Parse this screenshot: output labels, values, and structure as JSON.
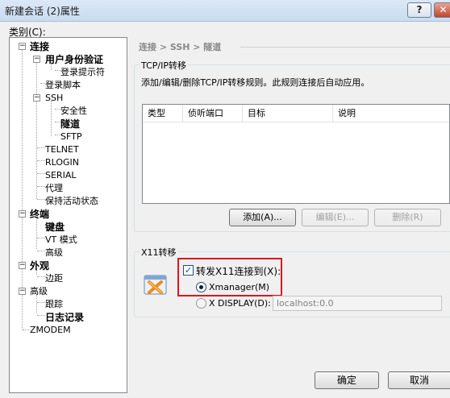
{
  "window": {
    "title": "新建会话 (2)属性",
    "help_label": "?",
    "close_label": "✕"
  },
  "category": {
    "label": "类别(C):",
    "tree": [
      {
        "label": "连接",
        "bold": true
      },
      {
        "label": "用户身份验证",
        "bold": true
      },
      {
        "label": "登录提示符",
        "bold": false
      },
      {
        "label": "登录脚本",
        "bold": false
      },
      {
        "label": "SSH",
        "bold": false
      },
      {
        "label": "安全性",
        "bold": false
      },
      {
        "label": "隧道",
        "bold": true
      },
      {
        "label": "SFTP",
        "bold": false
      },
      {
        "label": "TELNET",
        "bold": false
      },
      {
        "label": "RLOGIN",
        "bold": false
      },
      {
        "label": "SERIAL",
        "bold": false
      },
      {
        "label": "代理",
        "bold": false
      },
      {
        "label": "保持活动状态",
        "bold": false
      },
      {
        "label": "终端",
        "bold": true
      },
      {
        "label": "键盘",
        "bold": true
      },
      {
        "label": "VT 模式",
        "bold": false
      },
      {
        "label": "高级",
        "bold": false
      },
      {
        "label": "外观",
        "bold": true
      },
      {
        "label": "边距",
        "bold": false
      },
      {
        "label": "高级",
        "bold": false
      },
      {
        "label": "跟踪",
        "bold": false
      },
      {
        "label": "日志记录",
        "bold": true
      },
      {
        "label": "ZMODEM",
        "bold": false
      }
    ]
  },
  "breadcrumb": "连接 > SSH > 隧道",
  "tcpip": {
    "title": "TCP/IP转移",
    "description": "添加/编辑/删除TCP/IP转移规则。此规则连接后自动应用。",
    "columns": [
      "类型",
      "侦听端口",
      "目标",
      "说明"
    ],
    "add_label": "添加(A)...",
    "edit_label": "编辑(E)...",
    "delete_label": "删除(R)"
  },
  "x11": {
    "title": "X11转移",
    "forward_label": "转发X11连接到(X):",
    "forward_checked": true,
    "xmanager_label": "Xmanager(M)",
    "xdisplay_label": "X DISPLAY(D):",
    "xdisplay_value": "localhost:0.0",
    "highlight_color": "#e0141e"
  },
  "footer": {
    "ok_label": "确定",
    "cancel_label": "取消"
  }
}
